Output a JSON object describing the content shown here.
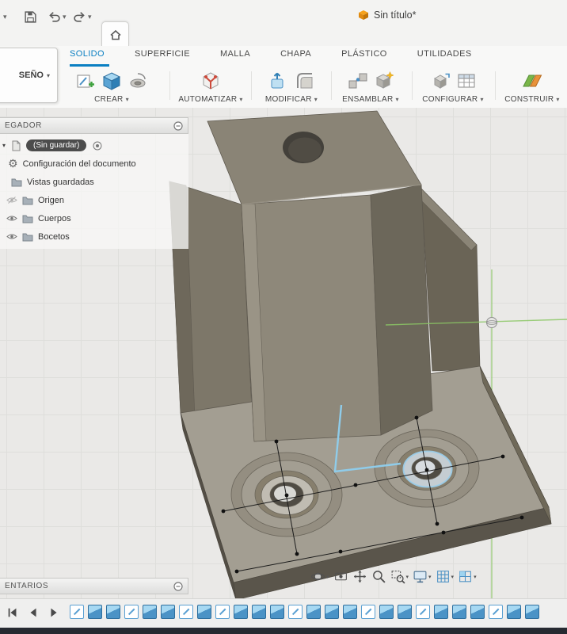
{
  "ui": {
    "caret": "▾"
  },
  "titlebar": {
    "document": "Sin título*"
  },
  "workspace": {
    "label": "SEÑO"
  },
  "tabs": {
    "items": [
      "SOLIDO",
      "SUPERFICIE",
      "MALLA",
      "CHAPA",
      "PLÁSTICO",
      "UTILIDADES"
    ],
    "active": "SOLIDO"
  },
  "ribbon": {
    "groups": [
      {
        "label": "CREAR"
      },
      {
        "label": "AUTOMATIZAR"
      },
      {
        "label": "MODIFICAR"
      },
      {
        "label": "ENSAMBLAR"
      },
      {
        "label": "CONFIGURAR"
      },
      {
        "label": "CONSTRUIR"
      }
    ]
  },
  "browser": {
    "header": "EGADOR",
    "document_pill": "(Sin guardar)",
    "items": [
      {
        "label": "Configuración del documento"
      },
      {
        "label": "Vistas guardadas"
      },
      {
        "label": "Origen",
        "visibility": "hidden"
      },
      {
        "label": "Cuerpos",
        "visibility": "visible"
      },
      {
        "label": "Bocetos",
        "visibility": "visible"
      }
    ]
  },
  "comments": {
    "header": "ENTARIOS"
  },
  "viewport": {
    "origin_axis_color": "#8bc765",
    "sketch_highlight_color": "#8fccea",
    "accent_blue": "#0a7fc2"
  },
  "nav_toolbar": {
    "icons": [
      "orbit",
      "look-at",
      "pan",
      "zoom",
      "zoom-window",
      "display-settings",
      "grid-display",
      "viewports"
    ]
  },
  "timeline": {
    "items": [
      "sketch",
      "feature",
      "feature",
      "sketch",
      "feature",
      "feature",
      "sketch",
      "feature",
      "sketch",
      "feature",
      "feature",
      "feature",
      "sketch",
      "feature",
      "feature",
      "feature",
      "sketch",
      "feature",
      "feature",
      "sketch",
      "feature",
      "feature",
      "feature",
      "sketch",
      "feature",
      "feature"
    ]
  }
}
